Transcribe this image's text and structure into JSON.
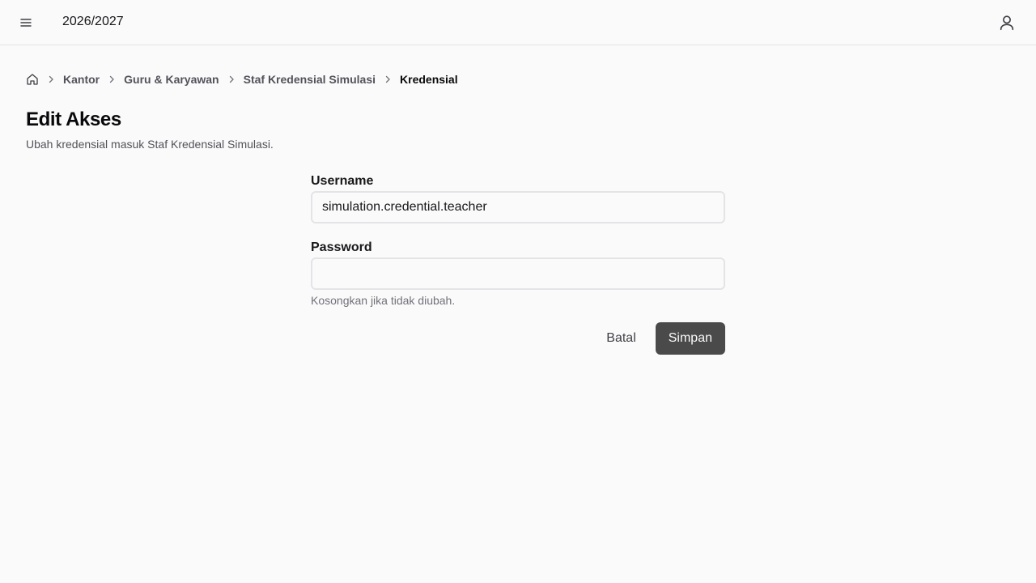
{
  "header": {
    "menu_icon": "hamburger-menu-icon",
    "academic_year": "2026/2027",
    "user_icon": "user-icon"
  },
  "breadcrumb": {
    "home_icon": "home-icon",
    "items": [
      "Kantor",
      "Guru & Karyawan",
      "Staf Kredensial Simulasi"
    ],
    "current": "Kredensial"
  },
  "page": {
    "title": "Edit Akses",
    "subtitle": "Ubah kredensial masuk Staf Kredensial Simulasi."
  },
  "form": {
    "username": {
      "label": "Username",
      "value": "simulation.credential.teacher"
    },
    "password": {
      "label": "Password",
      "value": "",
      "hint": "Kosongkan jika tidak diubah."
    },
    "cancel_label": "Batal",
    "submit_label": "Simpan"
  },
  "colors": {
    "background": "#fafafa",
    "primary_button": "#4a4a4a",
    "border": "#e4e4e7"
  }
}
